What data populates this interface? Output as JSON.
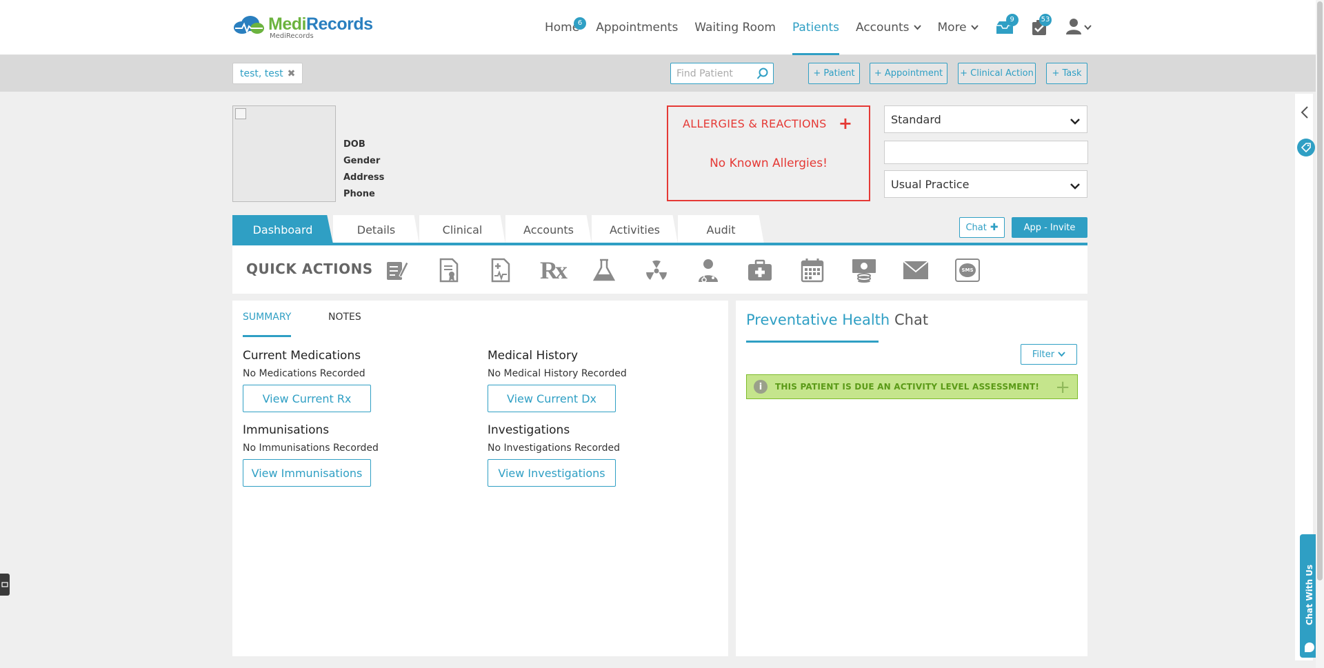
{
  "colors": {
    "accent": "#2f9fc4",
    "danger": "#e53935",
    "success_bg": "#c5e58c",
    "success_text": "#5a9a17"
  },
  "logo": {
    "title_part1": "Medi",
    "title_part2": "Records",
    "subtitle": "MediRecords"
  },
  "nav": {
    "home": "Home",
    "home_badge": "6",
    "appointments": "Appointments",
    "waiting_room": "Waiting Room",
    "patients": "Patients",
    "accounts": "Accounts",
    "more": "More",
    "mail_badge": "9",
    "tasks_badge": "53"
  },
  "subbar": {
    "patient_chip": "test, test",
    "chip_close": "✖",
    "find_placeholder": "Find Patient",
    "add_patient": "+ Patient",
    "add_appointment": "+ Appointment",
    "add_clinical_action": "+ Clinical Action",
    "add_task": "+ Task"
  },
  "patient": {
    "dob_label": "DOB",
    "gender_label": "Gender",
    "address_label": "Address",
    "phone_label": "Phone"
  },
  "allergies": {
    "title": "ALLERGIES & REACTIONS",
    "add": "+",
    "message": "No Known Allergies!"
  },
  "selects": {
    "type": "Standard",
    "practice": "Usual Practice"
  },
  "tabs": [
    "Dashboard",
    "Details",
    "Clinical",
    "Accounts",
    "Activities",
    "Audit"
  ],
  "buttons": {
    "chat": "Chat",
    "chat_plus": "✚",
    "app_invite": "App - Invite"
  },
  "quick_actions": {
    "label": "QUICK ACTIONS",
    "icons": [
      "notes-icon",
      "certificate-icon",
      "health-record-icon",
      "prescription-icon",
      "lab-flask-icon",
      "radiation-icon",
      "doctor-icon",
      "medical-kit-icon",
      "calendar-icon",
      "billing-icon",
      "email-icon",
      "sms-icon"
    ],
    "rx": "Rx",
    "sms": "SMS"
  },
  "summary": {
    "tab_summary": "SUMMARY",
    "tab_notes": "NOTES",
    "medications_title": "Current Medications",
    "medications_text": "No Medications Recorded",
    "medications_btn": "View Current Rx",
    "history_title": "Medical History",
    "history_text": "No Medical History Recorded",
    "history_btn": "View Current Dx",
    "immunisations_title": "Immunisations",
    "immunisations_text": "No Immunisations Recorded",
    "immunisations_btn": "View Immunisations",
    "investigations_title": "Investigations",
    "investigations_text": "No Investigations Recorded",
    "investigations_btn": "View Investigations"
  },
  "right_panel": {
    "tab_preventative": "Preventative Health",
    "tab_chat": "Chat",
    "filter": "Filter",
    "alert_icon": "i",
    "alert_text": "THIS PATIENT IS DUE AN ACTIVITY LEVEL ASSESSMENT!",
    "alert_add": "+"
  },
  "side": {
    "chat_with_us": "Chat With Us"
  }
}
